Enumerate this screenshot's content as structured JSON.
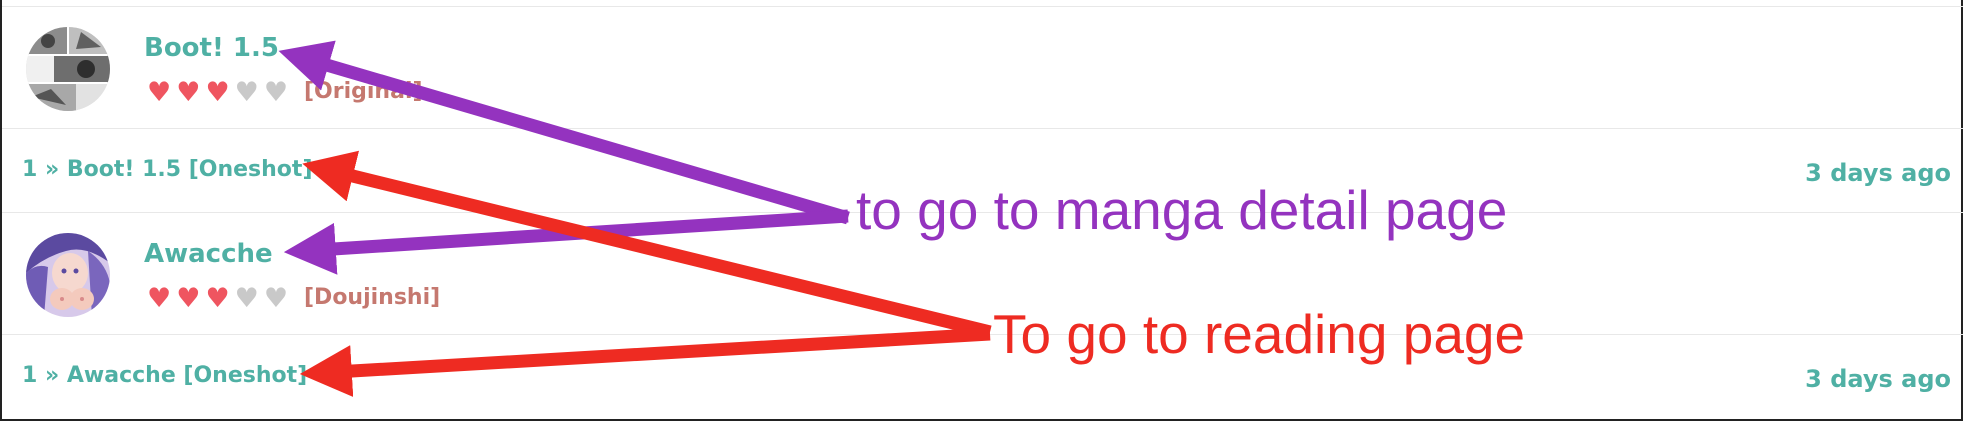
{
  "colors": {
    "title_teal": "#4fb0a4",
    "genre_brown": "#c5786f",
    "heart_on": "#ef5560",
    "heart_off": "#c9c9c9",
    "annotation_purple": "#9433bf",
    "annotation_red": "#ee2b22"
  },
  "manga_list": [
    {
      "title": "Boot! 1.5",
      "rating": 3,
      "rating_max": 5,
      "genre": "[Original]",
      "chapter": {
        "number": "1",
        "separator": "»",
        "label": "Boot! 1.5 [Oneshot]",
        "time": "3 days ago"
      }
    },
    {
      "title": "Awacche",
      "rating": 3,
      "rating_max": 5,
      "genre": "[Doujinshi]",
      "chapter": {
        "number": "1",
        "separator": "»",
        "label": "Awacche [Oneshot]",
        "time": "3 days ago"
      }
    }
  ],
  "annotations": {
    "detail": "to go to manga detail page",
    "reading": "To go to reading page"
  }
}
